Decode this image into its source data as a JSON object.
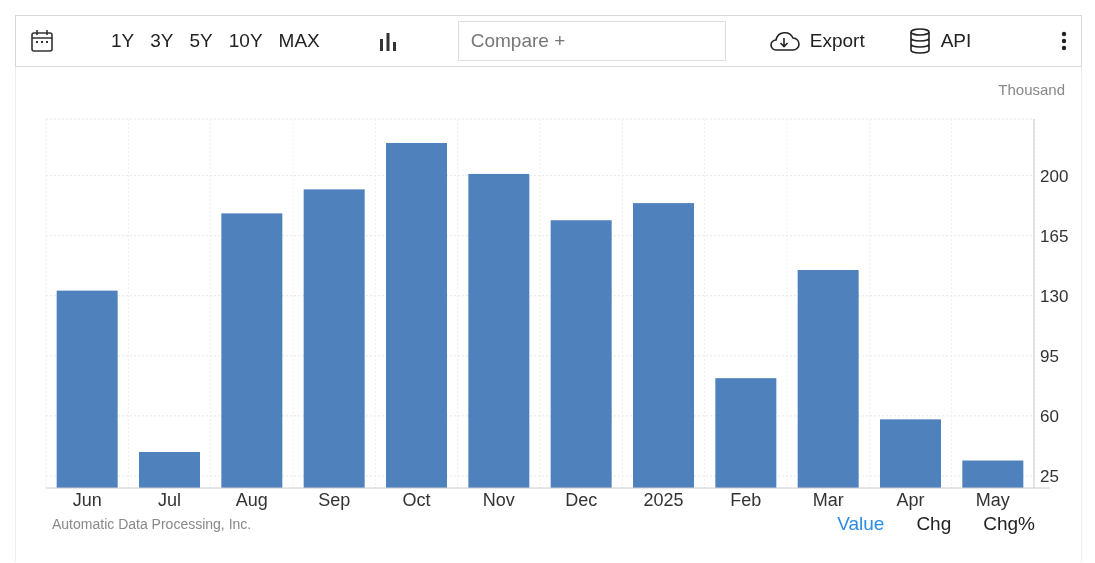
{
  "toolbar": {
    "ranges": [
      "1Y",
      "3Y",
      "5Y",
      "10Y",
      "MAX"
    ],
    "compare": {
      "placeholder": "Compare +"
    },
    "export": "Export",
    "api": "API"
  },
  "chart": {
    "unit": "Thousand",
    "chart_data": {
      "type": "bar",
      "categories": [
        "Jun",
        "Jul",
        "Aug",
        "Sep",
        "Oct",
        "Nov",
        "Dec",
        "2025",
        "Feb",
        "Mar",
        "Apr",
        "May"
      ],
      "values": [
        133,
        39,
        178,
        192,
        219,
        201,
        174,
        184,
        82,
        145,
        58,
        34
      ],
      "ylim": [
        18,
        233
      ],
      "yticks": [
        25,
        60,
        95,
        130,
        165,
        200
      ],
      "grid": true
    }
  },
  "footer": {
    "source": "Automatic Data Processing, Inc.",
    "views": [
      {
        "label": "Value",
        "selected": true
      },
      {
        "label": "Chg",
        "selected": false
      },
      {
        "label": "Chg%",
        "selected": false
      }
    ]
  }
}
